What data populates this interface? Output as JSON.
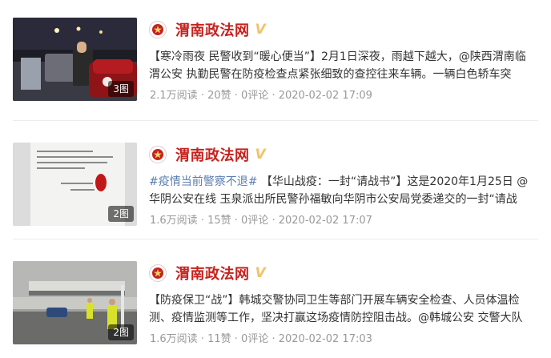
{
  "feed": [
    {
      "account": "渭南政法网",
      "verified_mark": "V",
      "image_count": "3图",
      "topic": "",
      "text": "【寒冷雨夜 民警收到“暖心便当”】2月1日深夜，雨越下越大，@陕西渭南临渭公安 执勤民警在防疫检查点紧张细致的查控往来车辆。一辆白色轿车突",
      "reads": "2.1万阅读",
      "likes": "20赞",
      "comments": "0评论",
      "time": "2020-02-02 17:09"
    },
    {
      "account": "渭南政法网",
      "verified_mark": "V",
      "image_count": "2图",
      "topic": "#疫情当前警察不退#",
      "text": "【华山战疫：一封“请战书”】这是2020年1月25日 @华阴公安在线 玉泉派出所民警孙福敏向华阴市公安局党委递交的一封“请战",
      "reads": "1.6万阅读",
      "likes": "15赞",
      "comments": "0评论",
      "time": "2020-02-02 17:07"
    },
    {
      "account": "渭南政法网",
      "verified_mark": "V",
      "image_count": "2图",
      "topic": "",
      "text": "【防疫保卫“战”】韩城交警协同卫生等部门开展车辆安全检查、人员体温检测、疫情监测等工作，坚决打赢这场疫情防控阻击战。@韩城公安 交警大队",
      "reads": "1.6万阅读",
      "likes": "11赞",
      "comments": "0评论",
      "time": "2020-02-02 17:03"
    }
  ],
  "meta_separator": " · ",
  "colors": {
    "account_name": "#c6221e",
    "verified": "#f1c36a",
    "topic_link": "#5b7eaf",
    "meta": "#999999"
  }
}
